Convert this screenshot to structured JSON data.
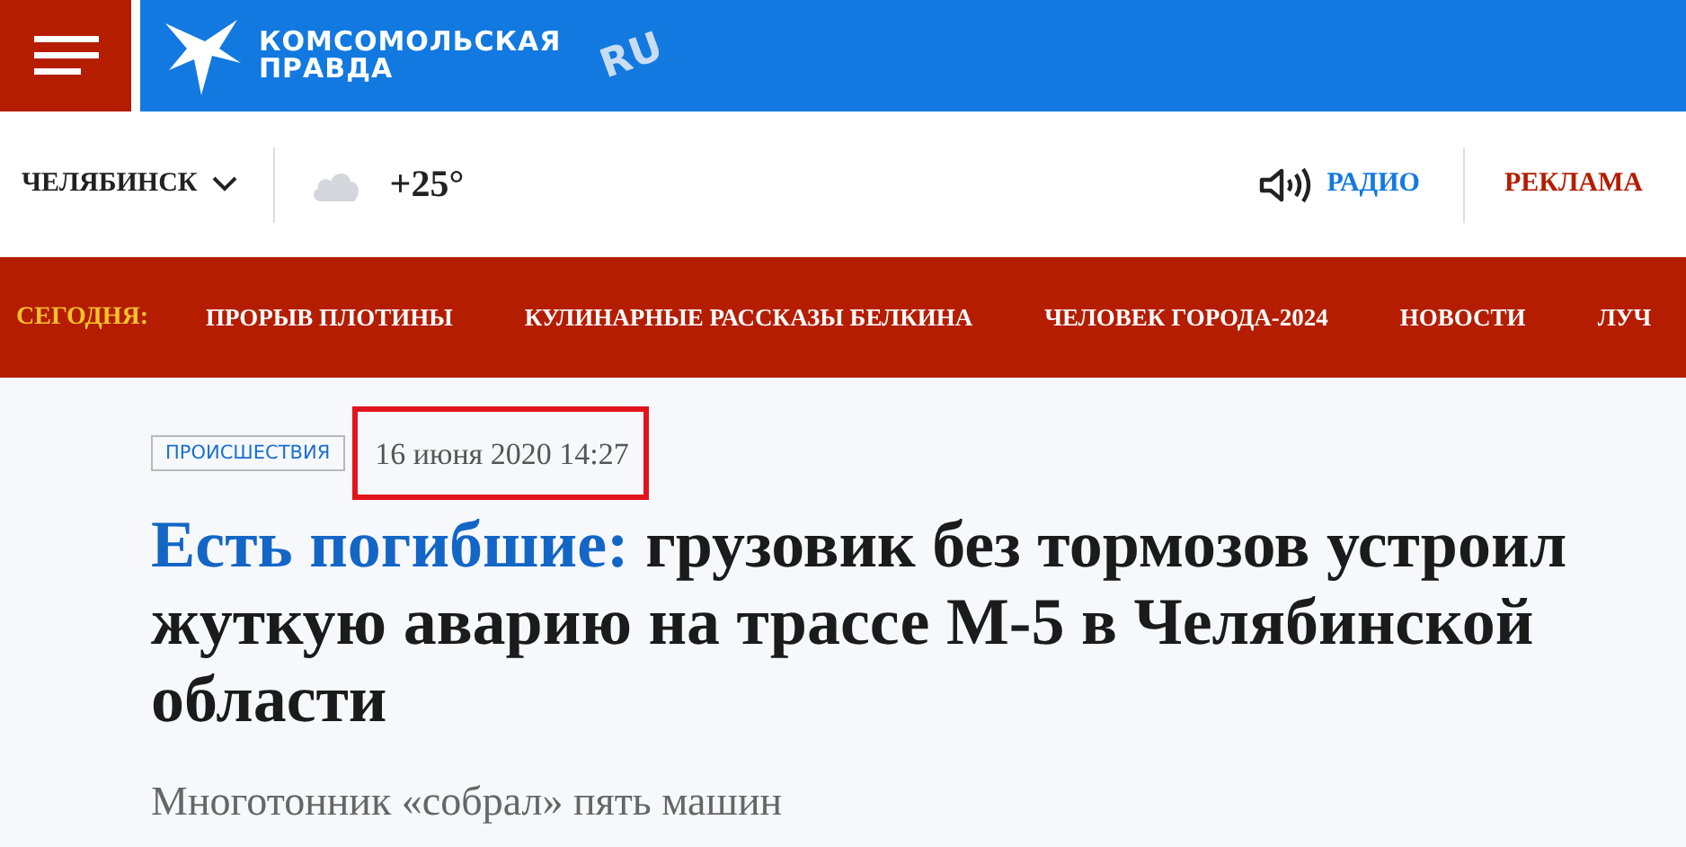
{
  "header": {
    "logo_line_1": "КОМСОМОЛЬСКАЯ",
    "logo_line_2": "ПРАВДА",
    "logo_badge": "RU"
  },
  "topbar": {
    "city": "ЧЕЛЯБИНСК",
    "temperature": "+25°",
    "radio": "РАДИО",
    "ads": "РЕКЛАМА"
  },
  "nav": {
    "label": "СЕГОДНЯ:",
    "items": [
      {
        "label": "ПРОРЫВ ПЛОТИНЫ"
      },
      {
        "label": "КУЛИНАРНЫЕ РАССКАЗЫ БЕЛКИНА"
      },
      {
        "label": "ЧЕЛОВЕК ГОРОДА-2024"
      },
      {
        "label": "НОВОСТИ"
      },
      {
        "label": "ЛУЧ"
      }
    ]
  },
  "article": {
    "rubric": "ПРОИСШЕСТВИЯ",
    "date": "16 июня 2020 14:27",
    "date_highlighted": true,
    "headline_lead": "Есть погибшие:",
    "headline": "грузовик без тормозов устроил жуткую аварию на трассе М-5 в Челябинской области",
    "subtitle": "Многотонник «собрал» пять машин"
  }
}
